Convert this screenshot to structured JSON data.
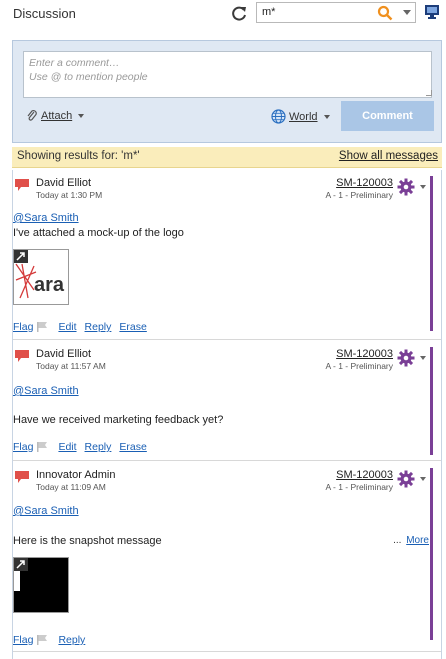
{
  "header": {
    "title": "Discussion",
    "search_value": "m*"
  },
  "composer": {
    "placeholder": "Enter a comment…\nUse @ to mention people",
    "attach_label": "Attach",
    "visibility_label": "World",
    "comment_button": "Comment"
  },
  "results": {
    "text": "Showing results for: 'm*'",
    "show_all": "Show all messages"
  },
  "messages": [
    {
      "author": "David Elliot",
      "time": "Today at 1:30 PM",
      "item_id": "SM-120003",
      "item_state": "A - 1 - Preliminary",
      "mention": "@Sara Smith",
      "body": "I've attached a mock-up of the logo",
      "thumb_text": "ara",
      "actions": {
        "flag": "Flag",
        "edit": "Edit",
        "reply": "Reply",
        "erase": "Erase"
      }
    },
    {
      "author": "David Elliot",
      "time": "Today at 11:57 AM",
      "item_id": "SM-120003",
      "item_state": "A - 1 - Preliminary",
      "mention": "@Sara Smith",
      "body": "Have we received marketing feedback yet?",
      "actions": {
        "flag": "Flag",
        "edit": "Edit",
        "reply": "Reply",
        "erase": "Erase"
      }
    },
    {
      "author": "Innovator Admin",
      "time": "Today at 11:09 AM",
      "item_id": "SM-120003",
      "item_state": "A - 1 - Preliminary",
      "mention": "@Sara Smith",
      "body": "Here is the snapshot message",
      "more_dots": "...",
      "more_label": "More",
      "actions": {
        "flag": "Flag",
        "reply": "Reply"
      }
    }
  ],
  "colors": {
    "accent_purple": "#7a3f96",
    "bubble_red": "#e0504a",
    "link_blue": "#1a5fb4",
    "results_bg": "#faedbb"
  }
}
